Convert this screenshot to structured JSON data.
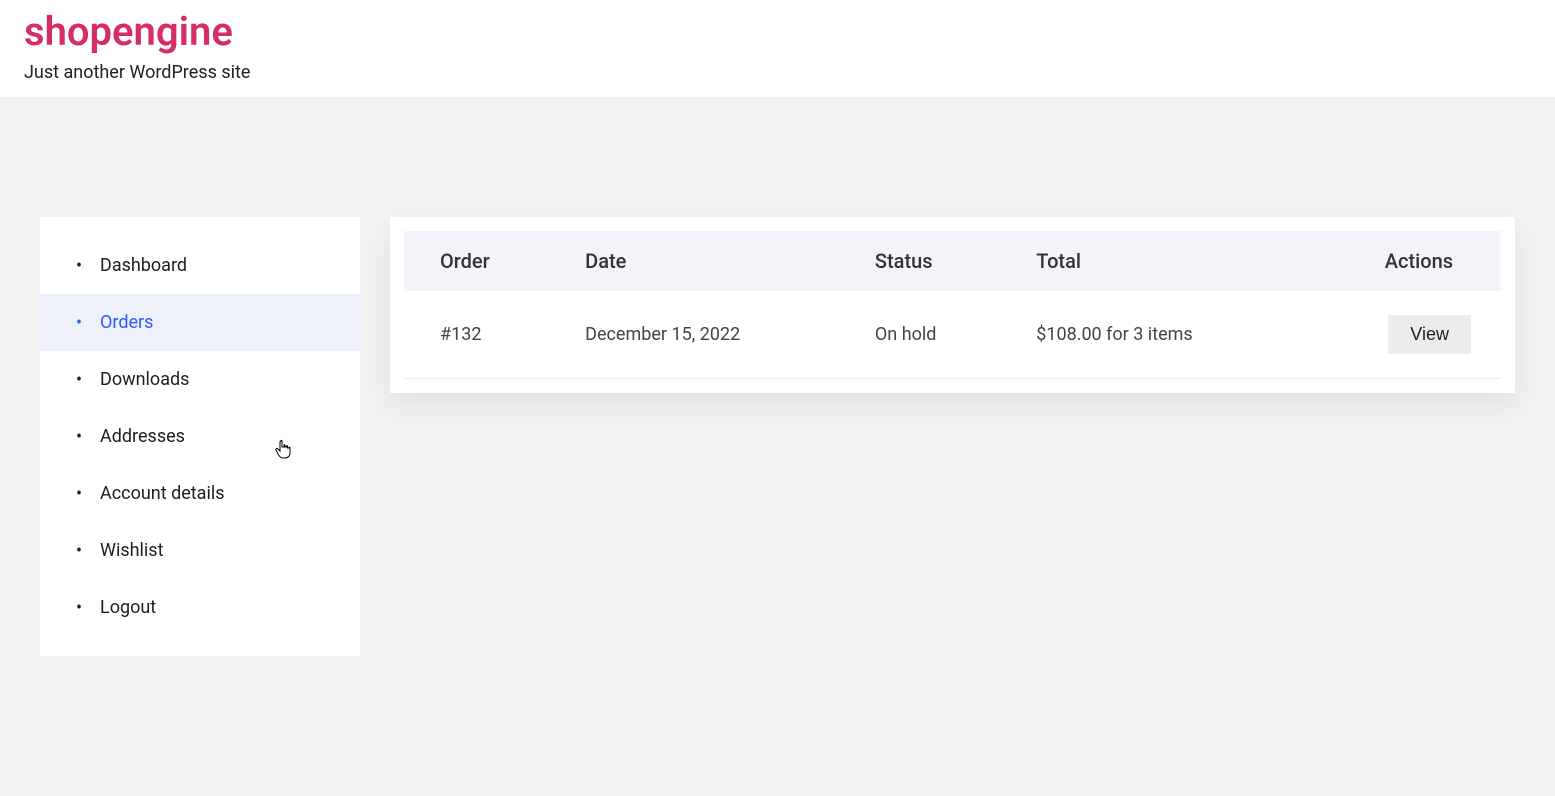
{
  "header": {
    "title": "shopengine",
    "tagline": "Just another WordPress site"
  },
  "sidebar": {
    "items": [
      {
        "label": "Dashboard",
        "active": false
      },
      {
        "label": "Orders",
        "active": true
      },
      {
        "label": "Downloads",
        "active": false
      },
      {
        "label": "Addresses",
        "active": false
      },
      {
        "label": "Account details",
        "active": false
      },
      {
        "label": "Wishlist",
        "active": false
      },
      {
        "label": "Logout",
        "active": false
      }
    ]
  },
  "orders": {
    "columns": {
      "order": "Order",
      "date": "Date",
      "status": "Status",
      "total": "Total",
      "actions": "Actions"
    },
    "rows": [
      {
        "order": "#132",
        "date": "December 15, 2022",
        "status": "On hold",
        "total": "$108.00 for 3 items",
        "view_label": "View"
      }
    ]
  }
}
